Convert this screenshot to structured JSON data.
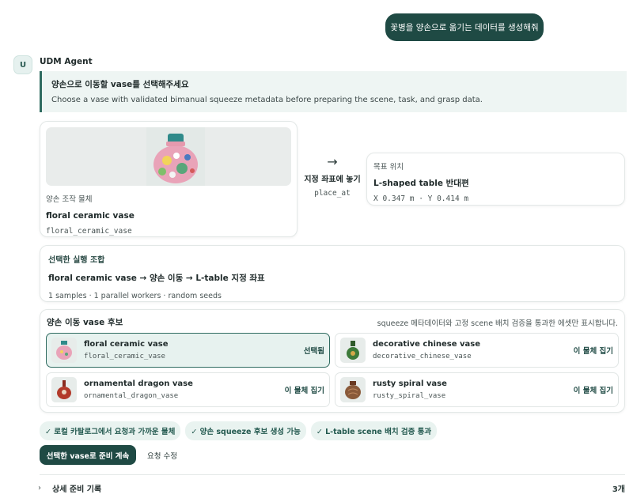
{
  "user_message": "꽃병을 양손으로 옮기는 데이터를 생성해줘",
  "agent": {
    "avatar_letter": "U",
    "name": "UDM Agent"
  },
  "instruction": {
    "title": "양손으로 이동할 vase를 선택해주세요",
    "description": "Choose a vase with validated bimanual squeeze metadata before preparing the scene, task, and grasp data."
  },
  "object_card": {
    "label": "양손 조작 물체",
    "name": "floral ceramic vase",
    "code": "floral_ceramic_vase"
  },
  "action": {
    "arrow": "→",
    "label": "지정 좌표에 놓기",
    "code": "place_at"
  },
  "target_card": {
    "label": "목표 위치",
    "name": "L-shaped table 반대편",
    "coords": "X 0.347 m · Y 0.414 m"
  },
  "combo_card": {
    "title": "선택한 실행 조합",
    "summary": "floral ceramic vase → 양손 이동 → L-table 지정 좌표",
    "meta": "1 samples · 1 parallel workers · random seeds"
  },
  "candidates": {
    "header": "양손 이동 vase 후보",
    "note": "squeeze 메타데이터와 고정 scene 배치 검증을 통과한 에셋만 표시합니다.",
    "items": [
      {
        "name": "floral ceramic vase",
        "code": "floral_ceramic_vase",
        "action": "선택됨",
        "selected": true,
        "color": "#d8a060"
      },
      {
        "name": "decorative chinese vase",
        "code": "decorative_chinese_vase",
        "action": "이 물체 집기",
        "selected": false,
        "color": "#3d7a3a"
      },
      {
        "name": "ornamental dragon vase",
        "code": "ornamental_dragon_vase",
        "action": "이 물체 집기",
        "selected": false,
        "color": "#b23a2a"
      },
      {
        "name": "rusty spiral vase",
        "code": "rusty_spiral_vase",
        "action": "이 물체 집기",
        "selected": false,
        "color": "#8a5a3a"
      }
    ]
  },
  "checks": [
    "✓ 로컬 카탈로그에서 요청과 가까운 물체",
    "✓ 양손 squeeze 후보 생성 가능",
    "✓ L-table scene 배치 검증 통과"
  ],
  "buttons": {
    "primary": "선택한 vase로 준비 계속",
    "secondary": "요청 수정"
  },
  "details": {
    "chevron": "›",
    "label": "상세 준비 기록",
    "count": "3개"
  }
}
